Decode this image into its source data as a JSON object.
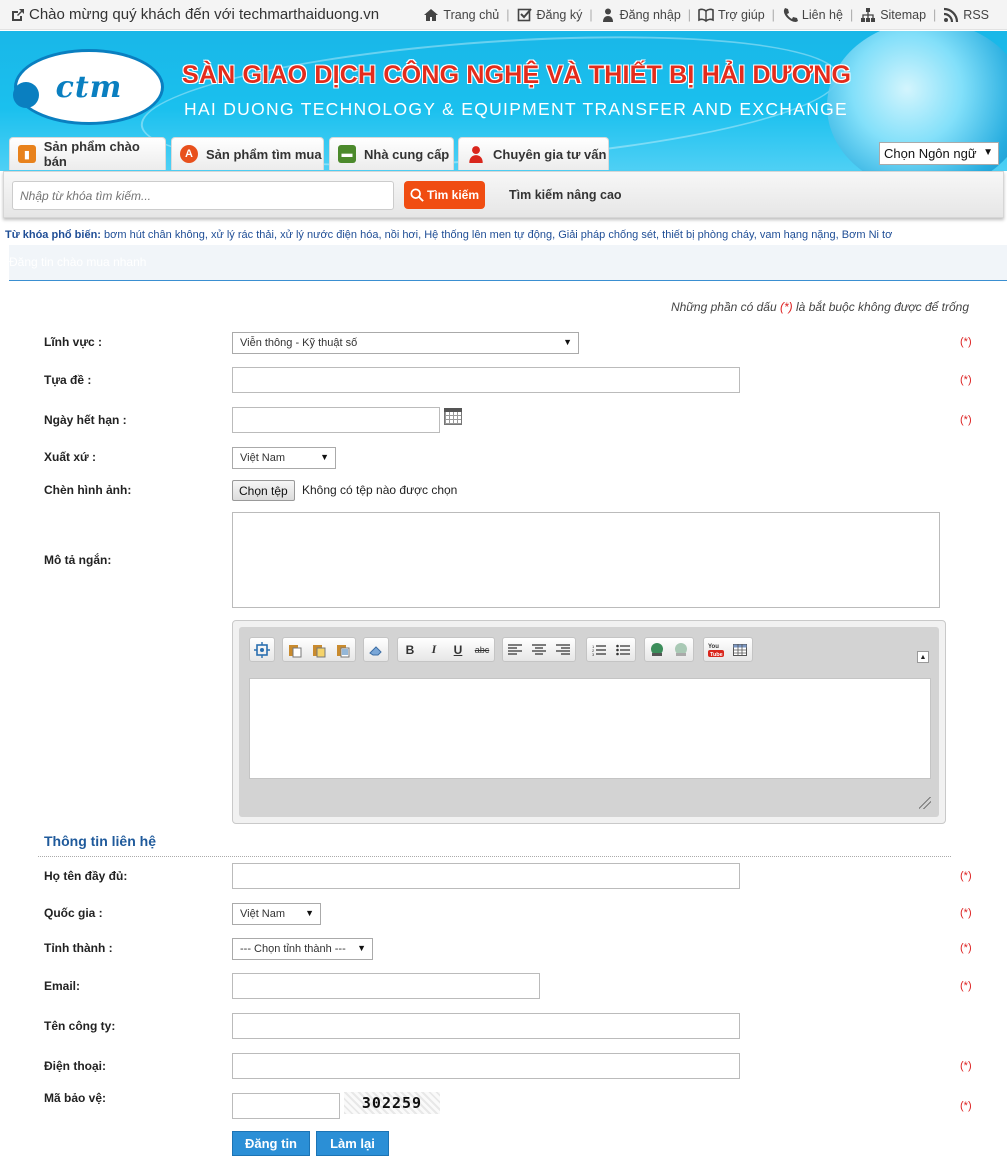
{
  "topbar": {
    "welcome": "Chào mừng quý khách đến với techmarthaiduong.vn",
    "links": [
      "Trang chủ",
      "Đăng ký",
      "Đăng nhập",
      "Trợ giúp",
      "Liên hệ",
      "Sitemap",
      "RSS"
    ]
  },
  "banner": {
    "title_vn": "SÀN GIAO DỊCH CÔNG NGHỆ VÀ THIẾT BỊ HẢI DƯƠNG",
    "title_en": "HAI DUONG TECHNOLOGY & EQUIPMENT TRANSFER AND EXCHANGE"
  },
  "tabs": [
    "Sản phẩm chào bán",
    "Sản phẩm tìm mua",
    "Nhà cung cấp",
    "Chuyên gia tư vấn"
  ],
  "language": {
    "selected": "Chọn Ngôn ngữ"
  },
  "search": {
    "placeholder": "Nhập từ khóa tìm kiếm...",
    "button": "Tìm kiếm",
    "advanced": "Tìm kiếm nâng cao"
  },
  "keywords": {
    "label": "Từ khóa phổ biến:",
    "items": [
      "bơm hút chân không",
      "xử lý rác thải",
      "xử lý nước điện hóa",
      "nồi hơi",
      "Hệ thống lên men tự động",
      "Giải pháp chống sét",
      "thiết bị phòng cháy",
      "vam hạng nặng",
      "Bơm Ni tơ"
    ]
  },
  "section_title": "Đăng tin chào mua nhanh",
  "required_note": {
    "prefix": "Những phần có dấu",
    "star": "(*)",
    "suffix": "là bắt buộc không được để trống"
  },
  "required_mark": "(*)",
  "form": {
    "field_label": "Lĩnh vực :",
    "field_value": "Viễn thông - Kỹ thuật số",
    "title_label": "Tựa đề :",
    "expiry_label": "Ngày hết hạn :",
    "origin_label": "Xuất xứ :",
    "origin_value": "Việt Nam",
    "image_label": "Chèn hình ảnh:",
    "file_button": "Chọn tệp",
    "file_none": "Không có tệp nào được chọn",
    "desc_label": "Mô tả ngắn:"
  },
  "contact": {
    "heading": "Thông tin liên hệ",
    "fullname_label": "Họ tên đầy đủ:",
    "country_label": "Quốc gia :",
    "country_value": "Việt Nam",
    "province_label": "Tỉnh thành :",
    "province_value": "--- Chọn tỉnh thành ---",
    "email_label": "Email:",
    "company_label": "Tên công ty:",
    "phone_label": "Điện thoại:",
    "captcha_label": "Mã bảo vệ:",
    "captcha_value": "302259"
  },
  "buttons": {
    "submit": "Đăng tin",
    "reset": "Làm lại"
  },
  "colors": {
    "banner": "#1ab9ea",
    "title_red": "#e32c1c",
    "search_button": "#f04d12",
    "action_button": "#2b8fd6",
    "required": "#dd2222"
  }
}
